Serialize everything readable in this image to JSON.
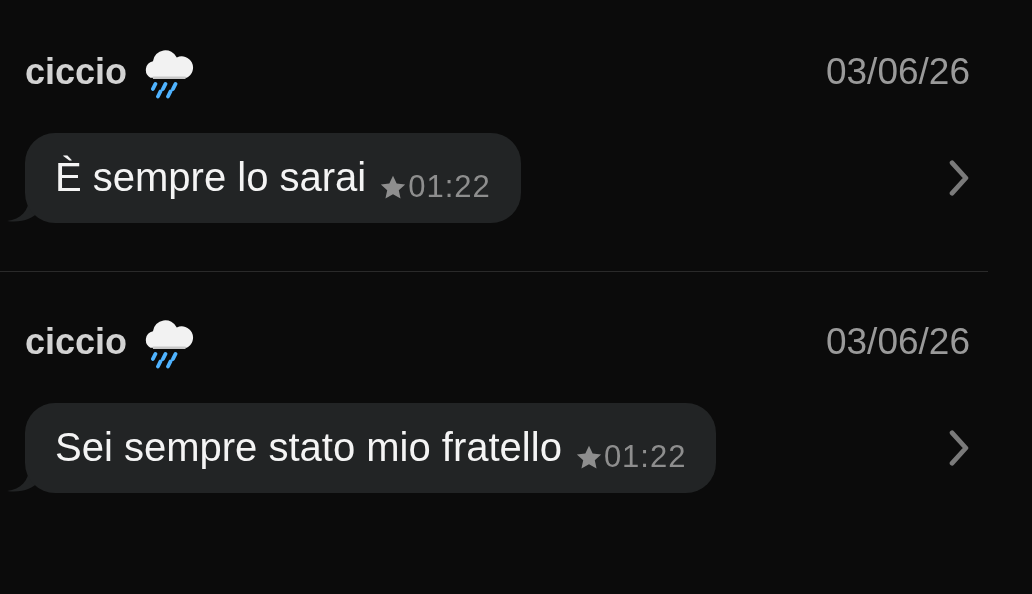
{
  "messages": [
    {
      "sender": "ciccio",
      "date": "03/06/26",
      "text": "È sempre lo sarai",
      "time": "01:22",
      "starred": true
    },
    {
      "sender": "ciccio",
      "date": "03/06/26",
      "text": "Sei sempre stato mio fratello",
      "time": "01:22",
      "starred": true
    }
  ]
}
